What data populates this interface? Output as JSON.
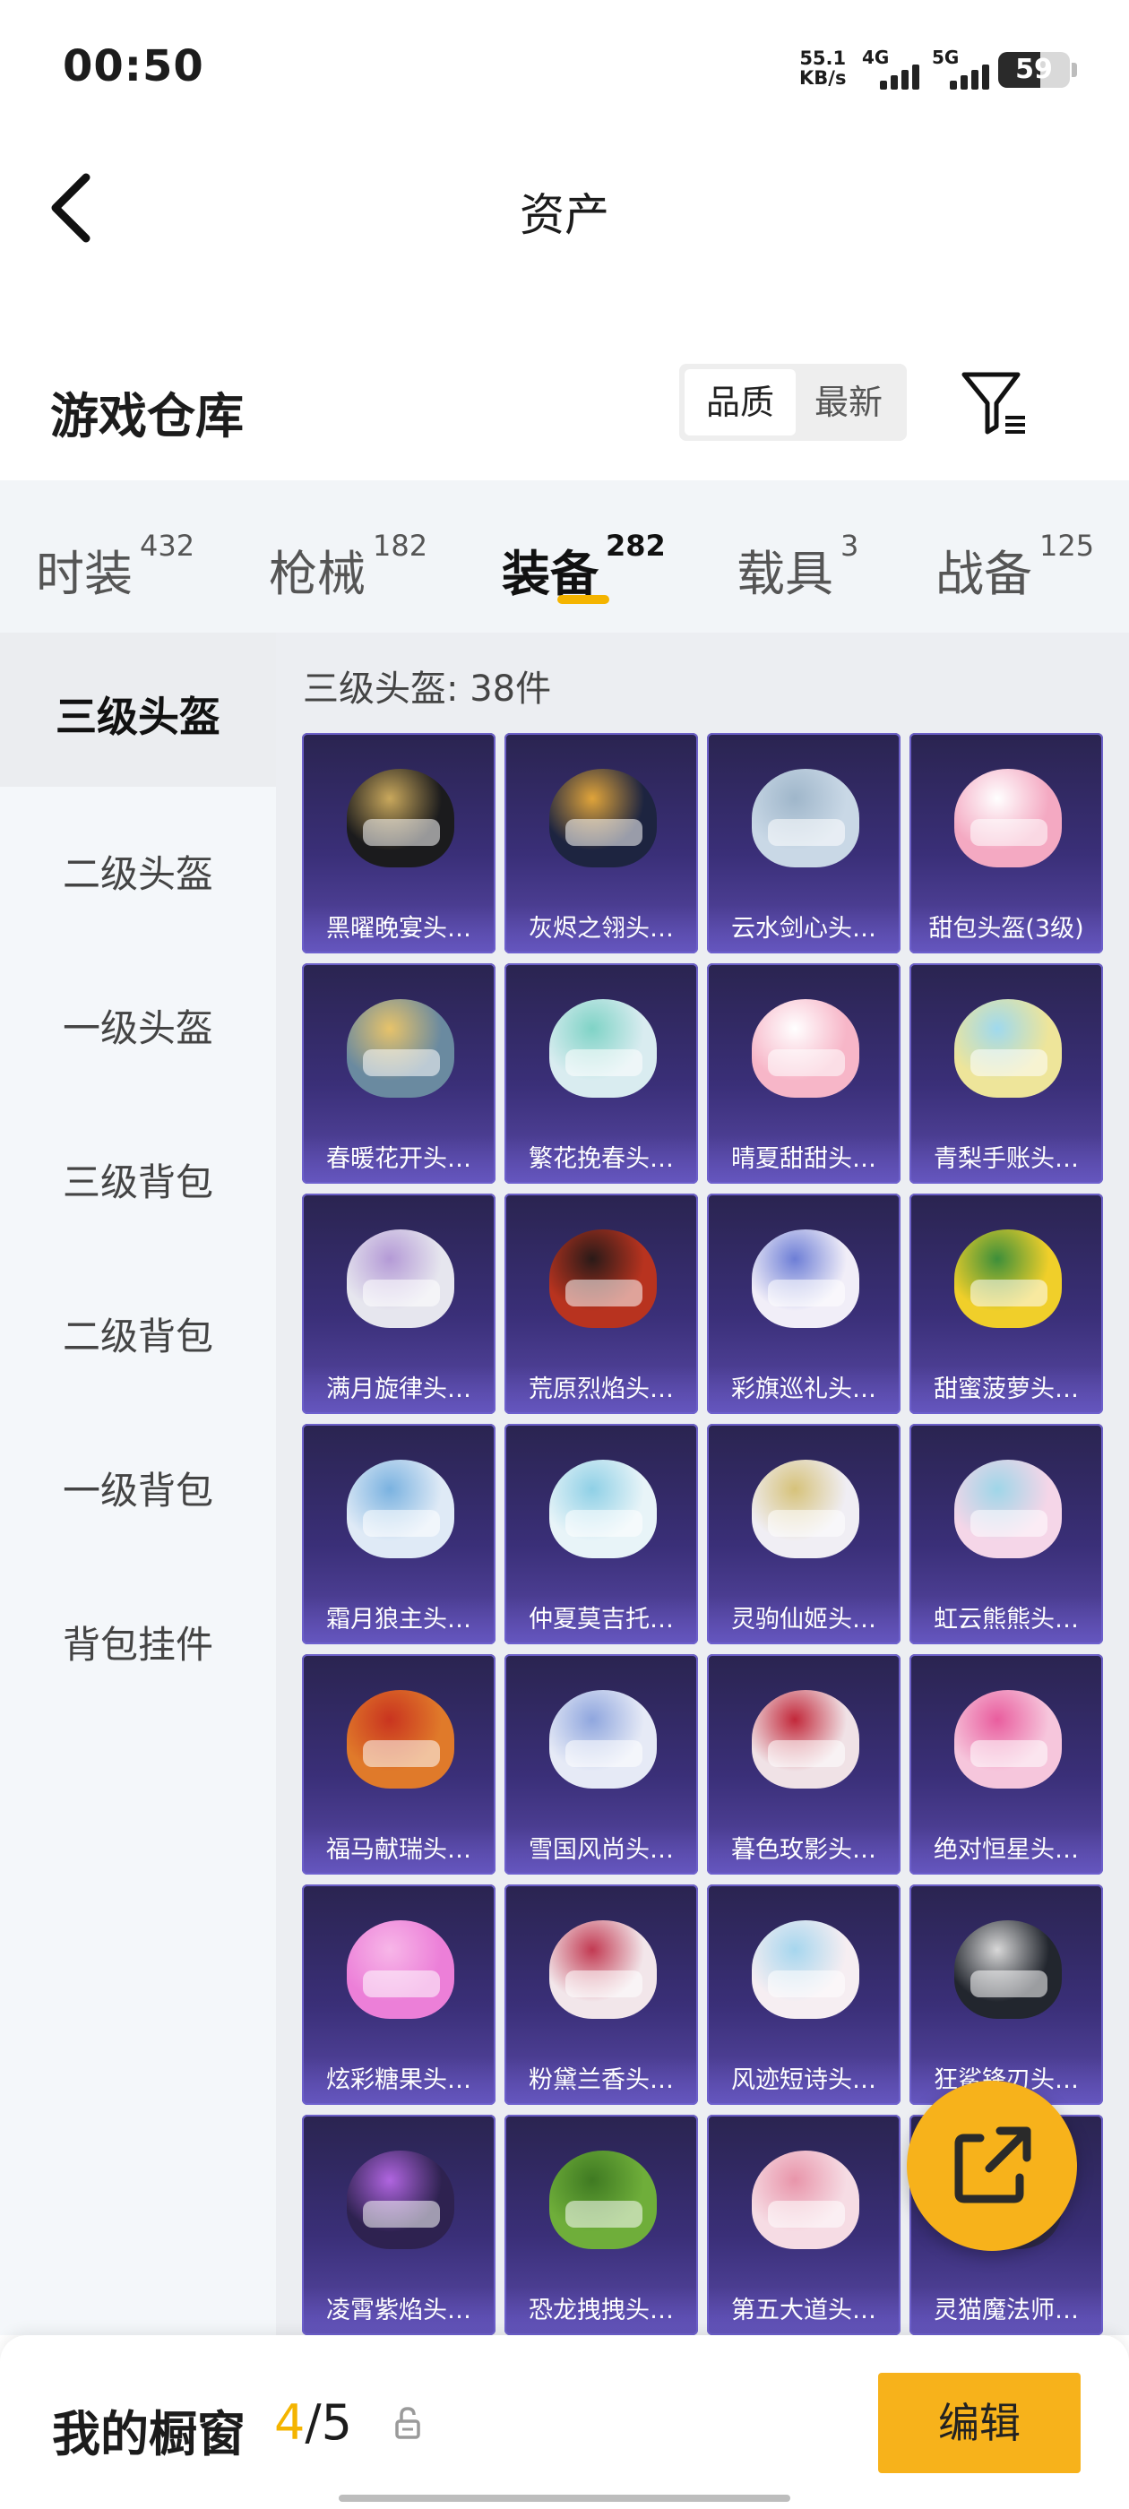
{
  "status_bar": {
    "time": "00:50",
    "net_speed": "55.1",
    "net_unit": "KB/s",
    "signal1_label": "4G",
    "signal2_label": "5G",
    "battery": "59"
  },
  "header": {
    "title": "资产",
    "back_icon": "chevron-left-icon"
  },
  "warehouse": {
    "title": "游戏仓库",
    "sort_options": [
      "品质",
      "最新"
    ],
    "sort_selected": "品质",
    "filter_icon": "filter-icon"
  },
  "tabs": [
    {
      "label": "时装",
      "count": "432"
    },
    {
      "label": "枪械",
      "count": "182"
    },
    {
      "label": "装备",
      "count": "282"
    },
    {
      "label": "载具",
      "count": "3"
    },
    {
      "label": "战备",
      "count": "125"
    }
  ],
  "active_tab": "装备",
  "side_nav": {
    "items": [
      "三级头盔",
      "二级头盔",
      "一级头盔",
      "三级背包",
      "二级背包",
      "一级背包",
      "背包挂件"
    ],
    "active": "三级头盔"
  },
  "grid": {
    "header": "三级头盔: 38件",
    "items": [
      {
        "name": "黑曜晚宴头…",
        "color": "#1b1b1d",
        "accent": "#c9a85c"
      },
      {
        "name": "灰烬之翎头…",
        "color": "#1d2440",
        "accent": "#e0a43a"
      },
      {
        "name": "云水剑心头…",
        "color": "#c9d8e6",
        "accent": "#9fb6ca"
      },
      {
        "name": "甜包头盔(3级)",
        "color": "#f4a9c2",
        "accent": "#ffffff"
      },
      {
        "name": "春暖花开头…",
        "color": "#6a8aa0",
        "accent": "#e7c36a"
      },
      {
        "name": "繁花挽春头…",
        "color": "#d9ecf0",
        "accent": "#7fd3c6"
      },
      {
        "name": "晴夏甜甜头…",
        "color": "#f7b6c8",
        "accent": "#ffffff"
      },
      {
        "name": "青梨手账头…",
        "color": "#eee59a",
        "accent": "#9fd9ee"
      },
      {
        "name": "满月旋律头…",
        "color": "#e6e6ee",
        "accent": "#b49ad6"
      },
      {
        "name": "荒原烈焰头…",
        "color": "#b8331f",
        "accent": "#2a1a18"
      },
      {
        "name": "彩旗巡礼头…",
        "color": "#f1eef8",
        "accent": "#6d7ed6"
      },
      {
        "name": "甜蜜菠萝头…",
        "color": "#f0cf2a",
        "accent": "#3d8f3a"
      },
      {
        "name": "霜月狼主头…",
        "color": "#dfeaf6",
        "accent": "#7ab2e0"
      },
      {
        "name": "仲夏莫吉托…",
        "color": "#e8f4f8",
        "accent": "#8fd0e6"
      },
      {
        "name": "灵驹仙姬头…",
        "color": "#f0eef4",
        "accent": "#d6c27a"
      },
      {
        "name": "虹云熊熊头…",
        "color": "#f5d6e8",
        "accent": "#9fd6e8"
      },
      {
        "name": "福马献瑞头…",
        "color": "#e07a2a",
        "accent": "#c9341f"
      },
      {
        "name": "雪国风尚头…",
        "color": "#e6eaf6",
        "accent": "#8fa6de"
      },
      {
        "name": "暮色玫影头…",
        "color": "#f0e2e6",
        "accent": "#c2283a"
      },
      {
        "name": "绝对恒星头…",
        "color": "#f6c6dc",
        "accent": "#e95d9e"
      },
      {
        "name": "炫彩糖果头…",
        "color": "#ec7fd8",
        "accent": "#f7b6e8"
      },
      {
        "name": "粉黛兰香头…",
        "color": "#f2e6ea",
        "accent": "#c23a52"
      },
      {
        "name": "风迹短诗头…",
        "color": "#f6eef2",
        "accent": "#a6d6ee"
      },
      {
        "name": "狂鲨锋刃头…",
        "color": "#22262e",
        "accent": "#d8d8d8"
      },
      {
        "name": "凌霄紫焰头…",
        "color": "#2e2250",
        "accent": "#b065e0"
      },
      {
        "name": "恐龙拽拽头…",
        "color": "#6fae3a",
        "accent": "#3f7a22"
      },
      {
        "name": "第五大道头…",
        "color": "#f6dce4",
        "accent": "#e895aa"
      },
      {
        "name": "灵猫魔法师…",
        "color": "#2f2a4a",
        "accent": "#d8c88c"
      }
    ]
  },
  "share_fab_icon": "share-external-icon",
  "bottom_bar": {
    "label": "我的橱窗",
    "current": "4",
    "separator": "/",
    "total": "5",
    "lock_icon": "lock-icon",
    "edit_label": "编辑"
  },
  "colors": {
    "accent": "#f7b21b",
    "tab_indicator": "#f4b400",
    "card_bg": "#3a2f78"
  }
}
